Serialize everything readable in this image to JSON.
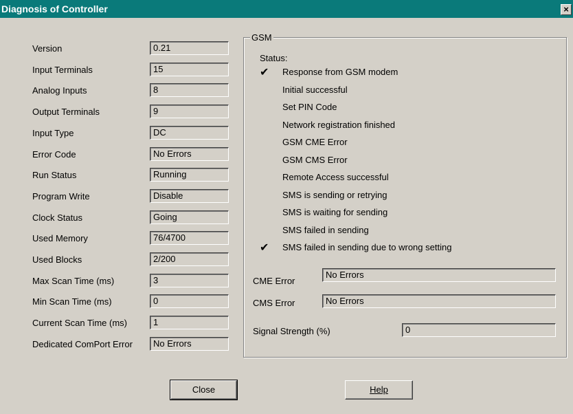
{
  "window": {
    "title": "Diagnosis of Controller",
    "close_glyph": "×"
  },
  "diagnostics": [
    {
      "label": "Version",
      "value": "0.21"
    },
    {
      "label": "Input Terminals",
      "value": "15"
    },
    {
      "label": "Analog Inputs",
      "value": "8"
    },
    {
      "label": "Output Terminals",
      "value": "9"
    },
    {
      "label": "Input Type",
      "value": "DC"
    },
    {
      "label": "Error Code",
      "value": "No Errors"
    },
    {
      "label": "Run Status",
      "value": "Running"
    },
    {
      "label": "Program Write",
      "value": "Disable"
    },
    {
      "label": "Clock Status",
      "value": "Going"
    },
    {
      "label": "Used Memory",
      "value": "76/4700"
    },
    {
      "label": "Used Blocks",
      "value": "2/200"
    },
    {
      "label": "Max Scan Time (ms)",
      "value": "3"
    },
    {
      "label": "Min Scan Time (ms)",
      "value": "0"
    },
    {
      "label": "Current Scan Time (ms)",
      "value": "1"
    },
    {
      "label": "Dedicated ComPort Error",
      "value": "No Errors"
    }
  ],
  "gsm": {
    "title": "GSM",
    "status_label": "Status:",
    "status_items": [
      {
        "label": "Response from GSM modem",
        "checked": true
      },
      {
        "label": "Initial successful",
        "checked": false
      },
      {
        "label": "Set PIN Code",
        "checked": false
      },
      {
        "label": "Network registration finished",
        "checked": false
      },
      {
        "label": "GSM CME Error",
        "checked": false
      },
      {
        "label": "GSM CMS Error",
        "checked": false
      },
      {
        "label": "Remote Access successful",
        "checked": false
      },
      {
        "label": "SMS is sending or retrying",
        "checked": false
      },
      {
        "label": "SMS is waiting for sending",
        "checked": false
      },
      {
        "label": "SMS failed in sending",
        "checked": false
      },
      {
        "label": "SMS failed in sending due to wrong setting",
        "checked": true
      }
    ],
    "check_glyph": "✔",
    "cme_error": {
      "label": "CME Error",
      "value": "No Errors"
    },
    "cms_error": {
      "label": "CMS Error",
      "value": "No Errors"
    },
    "signal_strength": {
      "label": "Signal Strength (%)",
      "value": "0"
    }
  },
  "buttons": {
    "close_label": "Close",
    "help_label": "Help"
  }
}
